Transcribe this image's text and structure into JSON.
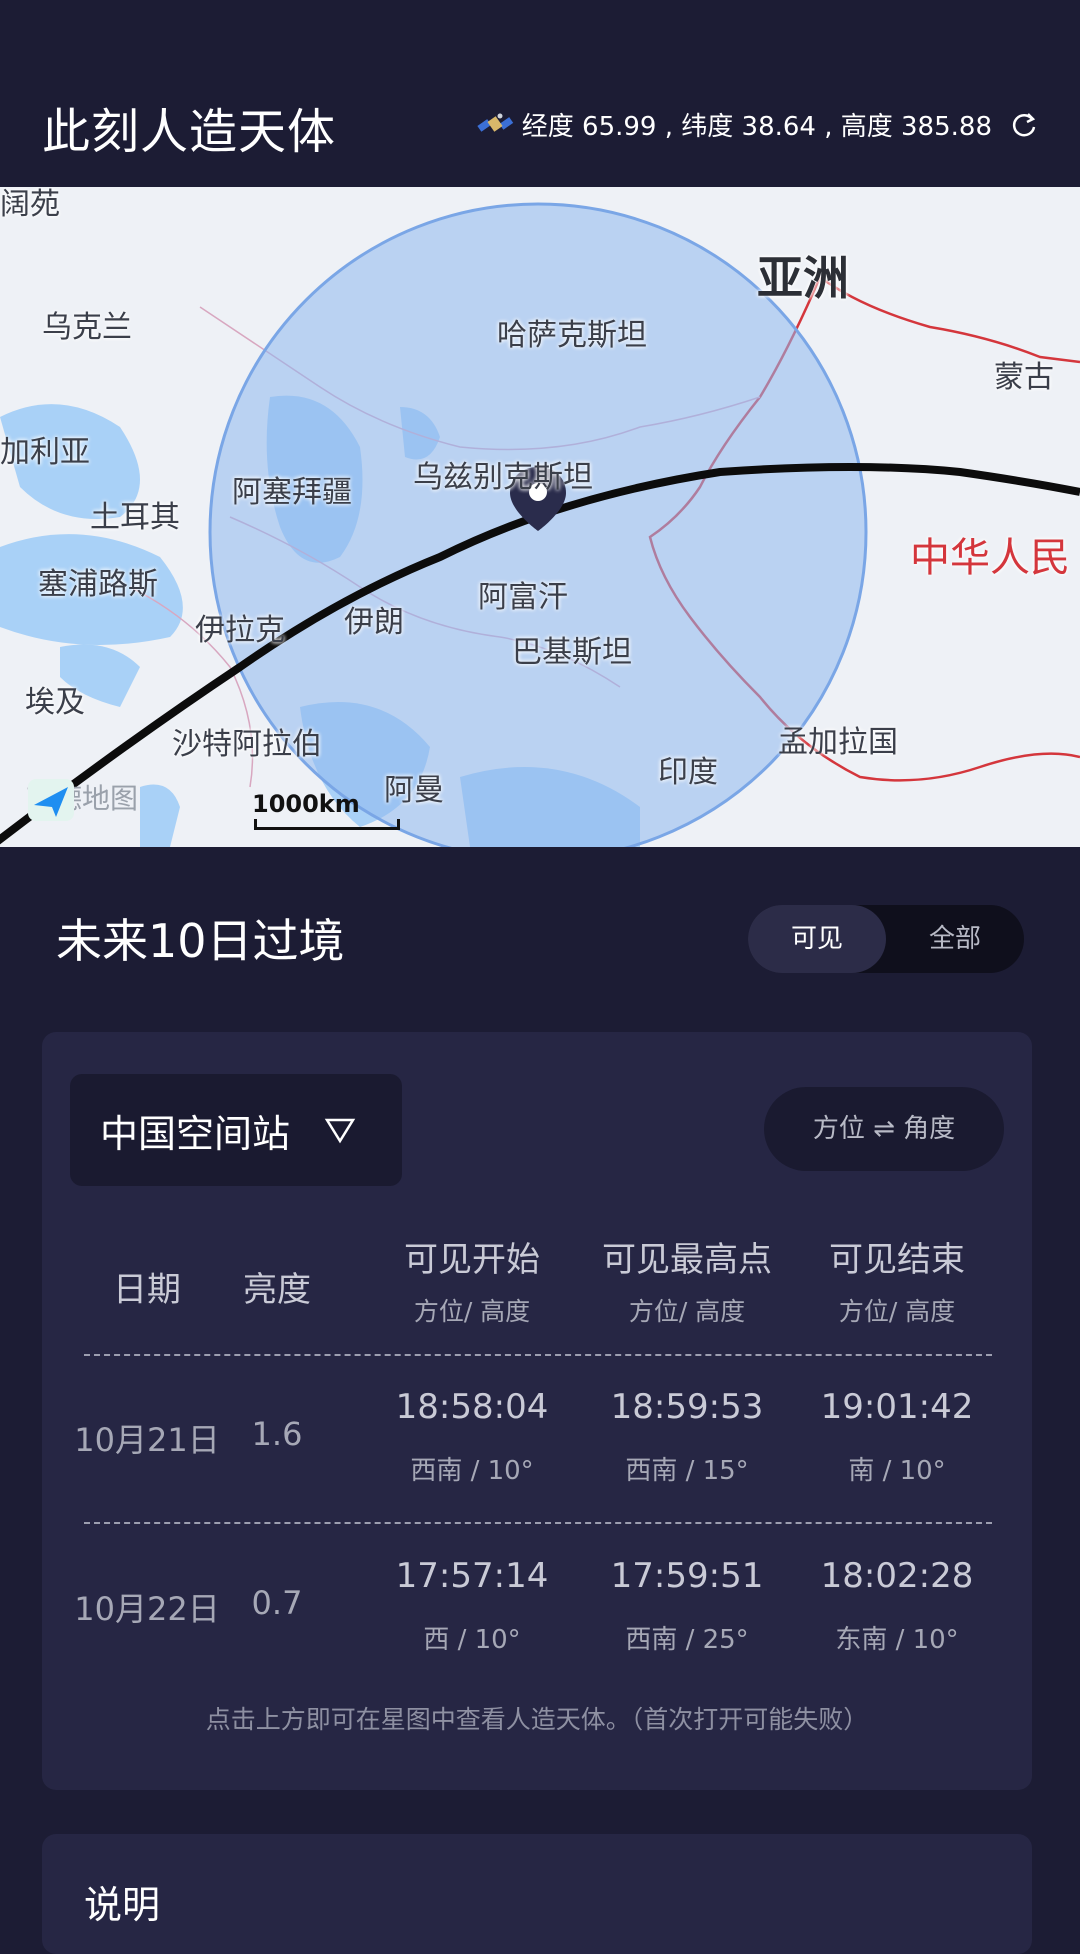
{
  "header": {
    "title": "此刻人造天体",
    "coords_text": "经度 65.99 , 纬度 38.64 , 高度 385.88"
  },
  "map": {
    "labels": {
      "asia": "亚洲",
      "ukraine": "乌克兰",
      "kazakhstan": "哈萨克斯坦",
      "mongolia": "蒙古",
      "bulgaria": "加利亚",
      "azerbaijan": "阿塞拜疆",
      "uzbekistan": "乌兹别克斯坦",
      "turkey": "土耳其",
      "china": "中华人民",
      "cyprus": "塞浦路斯",
      "afghanistan": "阿富汗",
      "iraq": "伊拉克",
      "iran": "伊朗",
      "pakistan": "巴基斯坦",
      "egypt": "埃及",
      "saudi": "沙特阿拉伯",
      "bangladesh": "孟加拉国",
      "oman": "阿曼",
      "india": "印度",
      "corner_top": "阔苑"
    },
    "logo_text": "高德地图",
    "scale_text": "1000km"
  },
  "passes": {
    "title": "未来10日过境",
    "toggle": {
      "visible": "可见",
      "all": "全部"
    },
    "satellite": "中国空间站",
    "swap_label": "方位 ⇌ 角度",
    "columns": {
      "date": "日期",
      "brightness": "亮度",
      "start": "可见开始",
      "peak": "可见最高点",
      "end": "可见结束",
      "sub": "方位/ 高度"
    },
    "rows": [
      {
        "date": "10月21日",
        "brightness": "1.6",
        "start_time": "18:58:04",
        "start_pos": "西南 / 10°",
        "peak_time": "18:59:53",
        "peak_pos": "西南 / 15°",
        "end_time": "19:01:42",
        "end_pos": "南 / 10°"
      },
      {
        "date": "10月22日",
        "brightness": "0.7",
        "start_time": "17:57:14",
        "start_pos": "西 / 10°",
        "peak_time": "17:59:51",
        "peak_pos": "西南 / 25°",
        "end_time": "18:02:28",
        "end_pos": "东南 / 10°"
      }
    ],
    "hint": "点击上方即可在星图中查看人造天体。（首次打开可能失败）"
  },
  "notes": {
    "title": "说明"
  },
  "colors": {
    "background": "#1c1c34",
    "card": "#262644",
    "coverage": "#8fb8ee",
    "track": "#111111",
    "border_red": "#d4363c"
  }
}
